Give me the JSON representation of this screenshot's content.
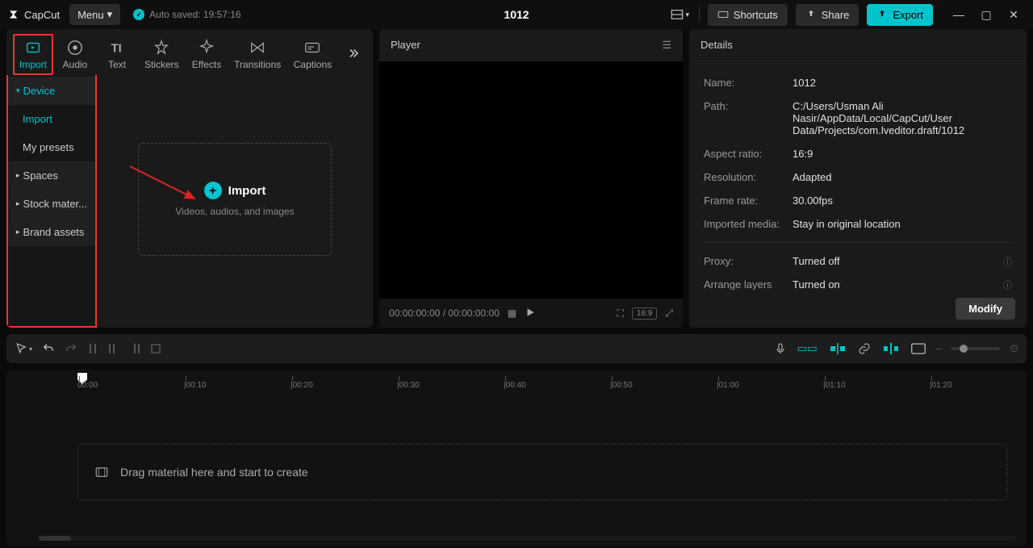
{
  "app": {
    "name": "CapCut"
  },
  "titlebar": {
    "menu_label": "Menu",
    "autosave_label": "Auto saved: 19:57:16",
    "project_title": "1012",
    "shortcuts_label": "Shortcuts",
    "share_label": "Share",
    "export_label": "Export"
  },
  "tabs": {
    "import": "Import",
    "audio": "Audio",
    "text": "Text",
    "stickers": "Stickers",
    "effects": "Effects",
    "transitions": "Transitions",
    "captions": "Captions"
  },
  "sidebar": {
    "device": "Device",
    "import": "Import",
    "my_presets": "My presets",
    "spaces": "Spaces",
    "stock": "Stock mater...",
    "brand": "Brand assets"
  },
  "import_box": {
    "label": "Import",
    "hint": "Videos, audios, and images"
  },
  "player": {
    "title": "Player",
    "timecode": "00:00:00:00 / 00:00:00:00",
    "ratio_badge": "16:9"
  },
  "details": {
    "title": "Details",
    "name_lbl": "Name:",
    "name_val": "1012",
    "path_lbl": "Path:",
    "path_val": "C:/Users/Usman Ali Nasir/AppData/Local/CapCut/User Data/Projects/com.lveditor.draft/1012",
    "aspect_lbl": "Aspect ratio:",
    "aspect_val": "16:9",
    "res_lbl": "Resolution:",
    "res_val": "Adapted",
    "fps_lbl": "Frame rate:",
    "fps_val": "30.00fps",
    "imported_lbl": "Imported media:",
    "imported_val": "Stay in original location",
    "proxy_lbl": "Proxy:",
    "proxy_val": "Turned off",
    "layers_lbl": "Arrange layers",
    "layers_val": "Turned on",
    "modify_btn": "Modify"
  },
  "timeline": {
    "drag_hint": "Drag material here and start to create",
    "ticks": [
      "00:00",
      "00:10",
      "00:20",
      "00:30",
      "00:40",
      "00:50",
      "01:00",
      "01:10",
      "01:20"
    ]
  }
}
